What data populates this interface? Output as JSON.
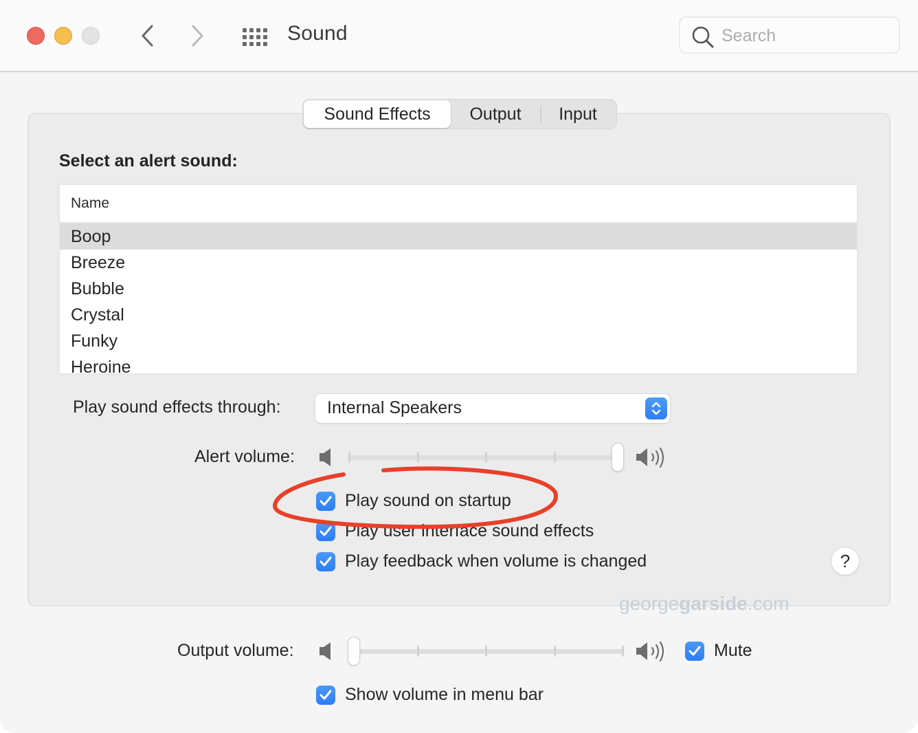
{
  "window": {
    "title": "Sound",
    "traffic_lights": [
      "close",
      "minimize",
      "zoom"
    ],
    "nav": {
      "back_icon": "chevron-left-icon",
      "forward_icon": "chevron-right-icon",
      "grid_icon": "show-all-grid-icon"
    },
    "search": {
      "placeholder": "Search",
      "value": "",
      "icon": "search-icon"
    }
  },
  "tabs": [
    {
      "label": "Sound Effects",
      "active": true
    },
    {
      "label": "Output",
      "active": false
    },
    {
      "label": "Input",
      "active": false
    }
  ],
  "sound_effects": {
    "section_label": "Select an alert sound:",
    "list": {
      "column_header": "Name",
      "items": [
        "Boop",
        "Breeze",
        "Bubble",
        "Crystal",
        "Funky",
        "Heroine"
      ],
      "selected": "Boop"
    },
    "play_through": {
      "label": "Play sound effects through:",
      "value": "Internal Speakers"
    },
    "alert_volume": {
      "label": "Alert volume:",
      "value_fraction": 1.0,
      "ticks": 5
    },
    "checkboxes": [
      {
        "label": "Play sound on startup",
        "checked": true
      },
      {
        "label": "Play user interface sound effects",
        "checked": true
      },
      {
        "label": "Play feedback when volume is changed",
        "checked": true
      }
    ],
    "help_label": "?"
  },
  "watermark": {
    "prefix": "george",
    "bold": "garside",
    "suffix": ".com"
  },
  "output_volume": {
    "label": "Output volume:",
    "value_fraction": 0.0,
    "ticks": 5,
    "mute": {
      "label": "Mute",
      "checked": true
    }
  },
  "show_volume_in_menu_bar": {
    "label": "Show volume in menu bar",
    "checked": true
  },
  "colors": {
    "accent": "#2f80f5",
    "annotation": "#e8402a",
    "close": "#ec6a5e",
    "minimize": "#f4bf4f",
    "zoom_inactive": "#e3e3e3"
  }
}
